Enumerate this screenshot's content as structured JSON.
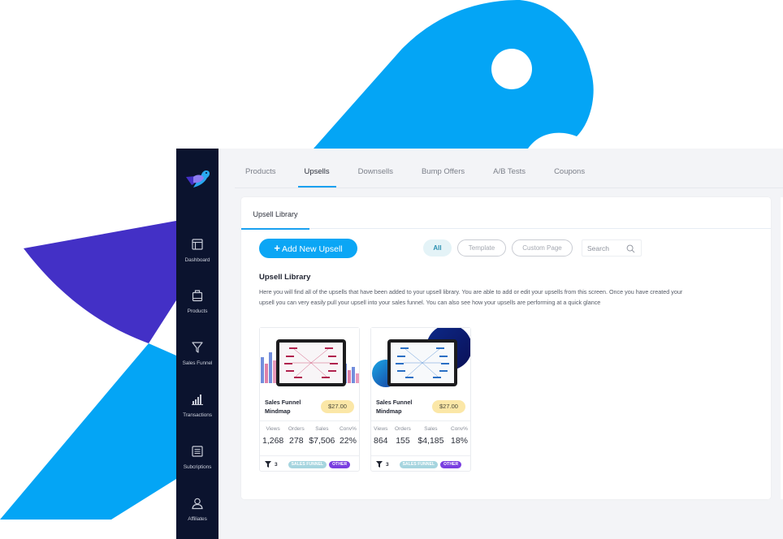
{
  "colors": {
    "brand_blue": "#04a5f5",
    "brand_purple": "#4330c6",
    "sidebar_bg": "#0b132e",
    "accent": "#1aa0f0",
    "price_badge": "#fbe7a7",
    "tag_sales_funnel": "#a6d5df",
    "tag_other": "#7a3fe0"
  },
  "sidebar": {
    "logo": "bird-logo",
    "items": [
      {
        "label": "Dashboard",
        "icon": "dashboard-icon"
      },
      {
        "label": "Products",
        "icon": "bag-icon"
      },
      {
        "label": "Sales Funnel",
        "icon": "funnel-icon"
      },
      {
        "label": "Transactions",
        "icon": "bar-chart-icon"
      },
      {
        "label": "Subcriptions",
        "icon": "list-icon"
      },
      {
        "label": "Affiliates",
        "icon": "user-icon"
      }
    ]
  },
  "header": {
    "tabs": [
      {
        "label": "Products",
        "active": false
      },
      {
        "label": "Upsells",
        "active": true
      },
      {
        "label": "Downsells",
        "active": false
      },
      {
        "label": "Bump Offers",
        "active": false
      },
      {
        "label": "A/B Tests",
        "active": false
      },
      {
        "label": "Coupons",
        "active": false
      }
    ]
  },
  "panel": {
    "tab_label": "Upsell Library",
    "add_button_label": "Add New Upsell",
    "filters": {
      "all": "All",
      "template": "Template",
      "custom": "Custom Page",
      "active": "All"
    },
    "search": {
      "placeholder": "Search",
      "value": ""
    },
    "title": "Upsell Library",
    "description": "Here you will find all of the upsells that have been added to your upsell library. You are able to add or edit your upsells from this screen. Once you have created your upsell you can very easily pull your upsell into your sales funnel. You can also see how your upsells are performing at a quick glance"
  },
  "cards": [
    {
      "name": "Sales Funnel Mindmap",
      "price": "$27.00",
      "stats": [
        {
          "label": "Views",
          "value": "1,268"
        },
        {
          "label": "Orders",
          "value": "278"
        },
        {
          "label": "Sales",
          "value": "$7,506"
        },
        {
          "label": "Conv%",
          "value": "22%"
        }
      ],
      "funnel_count": "3",
      "tags": [
        "SALES FUNNEL",
        "OTHER"
      ],
      "thumbnail_theme": "pink-bars"
    },
    {
      "name": "Sales Funnel Mindmap",
      "price": "$27.00",
      "stats": [
        {
          "label": "Views",
          "value": "864"
        },
        {
          "label": "Orders",
          "value": "155"
        },
        {
          "label": "Sales",
          "value": "$4,185"
        },
        {
          "label": "Conv%",
          "value": "18%"
        }
      ],
      "funnel_count": "3",
      "tags": [
        "SALES FUNNEL",
        "OTHER"
      ],
      "thumbnail_theme": "blue-circles"
    }
  ]
}
